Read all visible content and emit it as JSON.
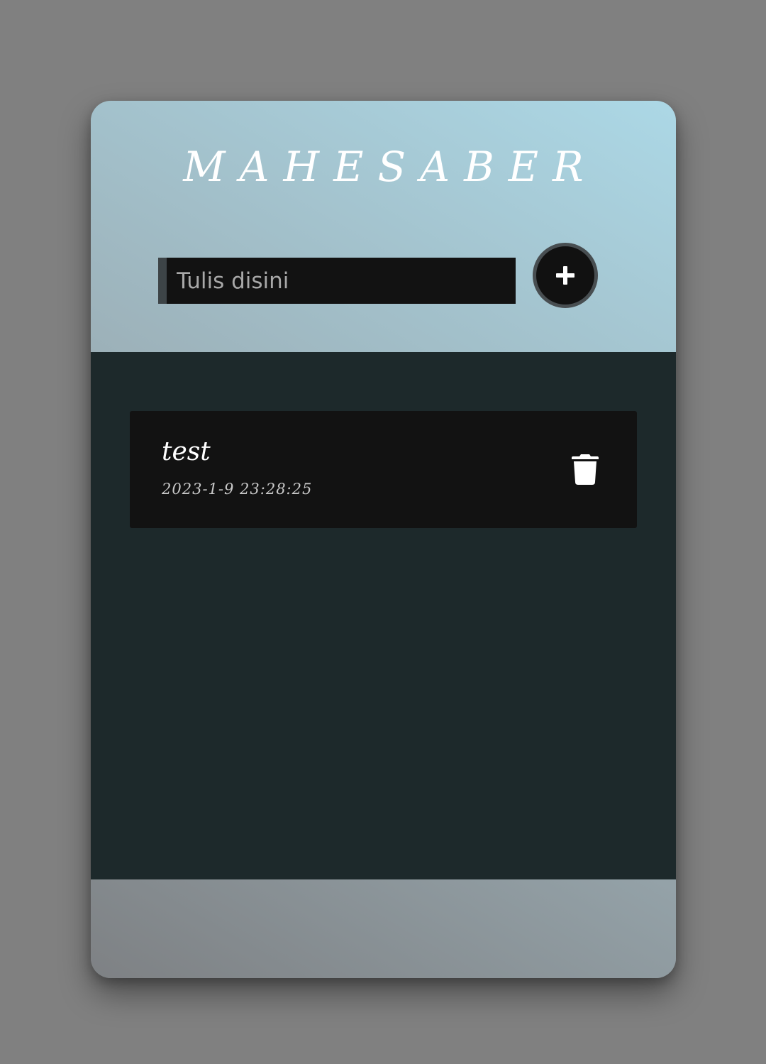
{
  "app": {
    "title": "MAHESABER"
  },
  "input": {
    "placeholder": "Tulis disini",
    "value": ""
  },
  "add_button": {
    "icon": "plus-icon"
  },
  "todos": [
    {
      "text": "test",
      "date": "2023-1-9 23:28:25",
      "delete_icon": "trash-icon"
    }
  ],
  "colors": {
    "page_background": "#808080",
    "list_background": "#1d292b",
    "item_background": "#121212",
    "input_background": "#121212",
    "input_accent": "#3d4447",
    "gradient_light": "#acd8e6",
    "gradient_dark": "#7e8184"
  }
}
